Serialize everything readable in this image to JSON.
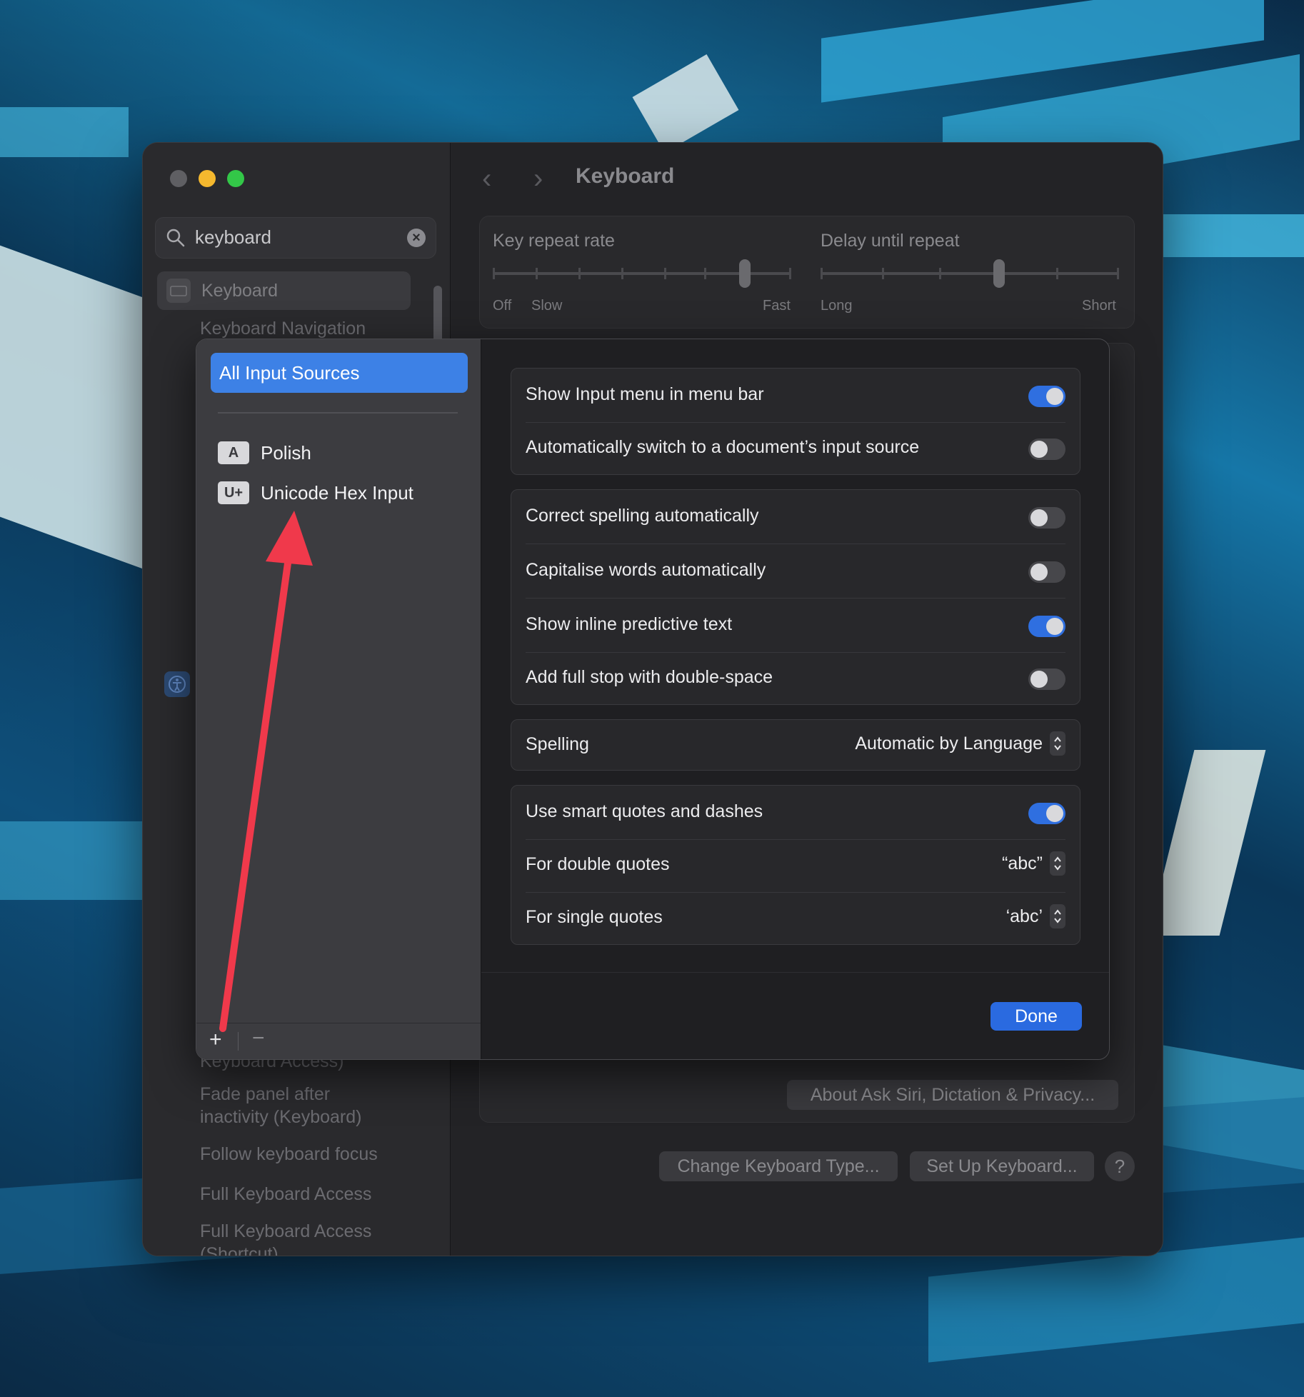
{
  "window": {
    "title": "Keyboard",
    "search_value": "keyboard"
  },
  "sidebar": {
    "items": [
      {
        "label": "Keyboard"
      },
      {
        "label": "Keyboard Navigation"
      },
      {
        "label": "Keyboard Access)"
      },
      {
        "label": "Fade panel after"
      },
      {
        "label": "inactivity (Keyboard)"
      },
      {
        "label": "Follow keyboard focus"
      },
      {
        "label": "Full Keyboard Access"
      },
      {
        "label": "Full Keyboard Access"
      },
      {
        "label": "(Shortcut)"
      }
    ]
  },
  "keyboard": {
    "key_repeat_label": "Key repeat rate",
    "key_repeat_marks": {
      "off": "Off",
      "slow": "Slow",
      "fast": "Fast"
    },
    "key_repeat_level": 0.85,
    "delay_label": "Delay until repeat",
    "delay_marks": {
      "long": "Long",
      "short": "Short"
    },
    "delay_level": 0.6,
    "about_button": "About Ask Siri, Dictation & Privacy...",
    "change_type_button": "Change Keyboard Type...",
    "setup_button": "Set Up Keyboard...",
    "help_button": "?"
  },
  "sheet": {
    "all_sources": "All Input Sources",
    "sources": [
      {
        "badge": "A",
        "name": "Polish"
      },
      {
        "badge": "U+",
        "name": "Unicode Hex Input"
      }
    ],
    "add_label": "+",
    "remove_label": "−",
    "group1": [
      {
        "label": "Show Input menu in menu bar",
        "on": true
      },
      {
        "label": "Automatically switch to a document’s input source",
        "on": false
      }
    ],
    "group2": [
      {
        "label": "Correct spelling automatically",
        "on": false
      },
      {
        "label": "Capitalise words automatically",
        "on": false
      },
      {
        "label": "Show inline predictive text",
        "on": true
      },
      {
        "label": "Add full stop with double-space",
        "on": false
      }
    ],
    "spelling": {
      "label": "Spelling",
      "value": "Automatic by Language"
    },
    "group4": {
      "smart_quotes": {
        "label": "Use smart quotes and dashes",
        "on": true
      },
      "double": {
        "label": "For double quotes",
        "value": "“abc”"
      },
      "single": {
        "label": "For single quotes",
        "value": "‘abc’"
      }
    },
    "done_label": "Done"
  },
  "colors": {
    "accent": "#2a6ae0",
    "selection": "#3d81e6",
    "annotation_arrow": "#f0394b",
    "close": "#5f5f63",
    "minimize": "#f5b82e",
    "zoom": "#33c748"
  }
}
